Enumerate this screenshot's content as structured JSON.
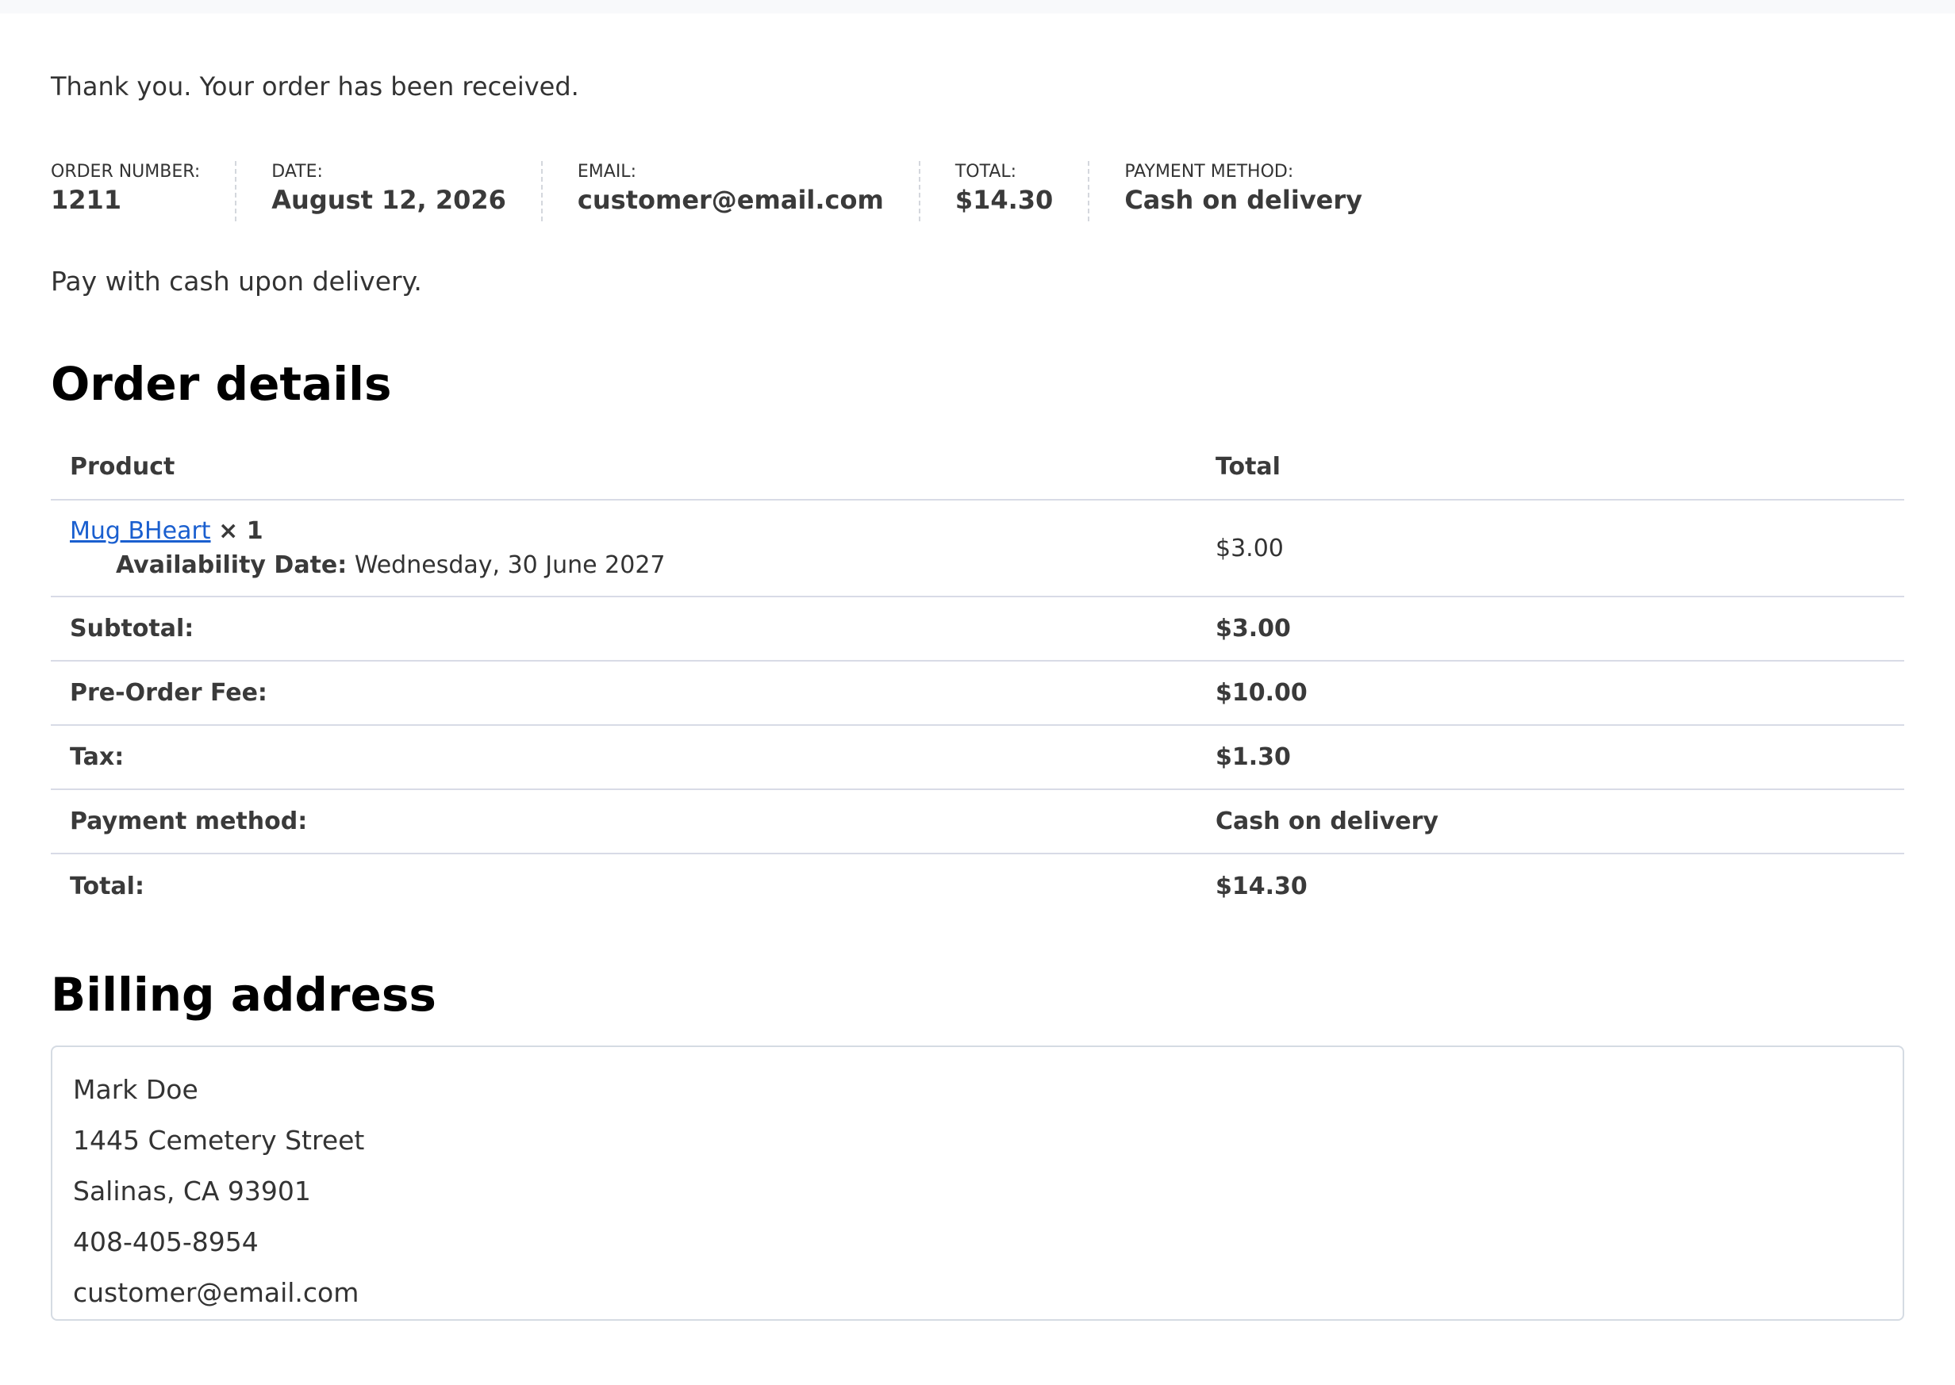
{
  "message": {
    "thanks": "Thank you. Your order has been received.",
    "payment_note": "Pay with cash upon delivery."
  },
  "overview": [
    {
      "label": "Order number:",
      "value": "1211"
    },
    {
      "label": "Date:",
      "value": "August 12, 2026"
    },
    {
      "label": "Email:",
      "value": "customer@email.com"
    },
    {
      "label": "Total:",
      "value": "$14.30"
    },
    {
      "label": "Payment method:",
      "value": "Cash on delivery"
    }
  ],
  "order_details": {
    "title": "Order details",
    "headers": {
      "product": "Product",
      "total": "Total"
    },
    "items": [
      {
        "name": "Mug BHeart",
        "quantity": "× 1",
        "meta_key": "Availability Date:",
        "meta_value": "Wednesday, 30 June 2027",
        "total": "$3.00"
      }
    ],
    "totals": [
      {
        "label": "Subtotal:",
        "value": "$3.00"
      },
      {
        "label": "Pre-Order Fee:",
        "value": "$10.00"
      },
      {
        "label": "Tax:",
        "value": "$1.30"
      },
      {
        "label": "Payment method:",
        "value": "Cash on delivery"
      },
      {
        "label": "Total:",
        "value": "$14.30"
      }
    ]
  },
  "billing": {
    "title": "Billing address",
    "name": "Mark Doe",
    "street": "1445 Cemetery Street",
    "city": "Salinas, CA 93901",
    "phone": "408-405-8954",
    "email": "customer@email.com"
  },
  "colors": {
    "link": "#1a5fcf",
    "border": "#d8dbe6",
    "heading": "#000000"
  }
}
